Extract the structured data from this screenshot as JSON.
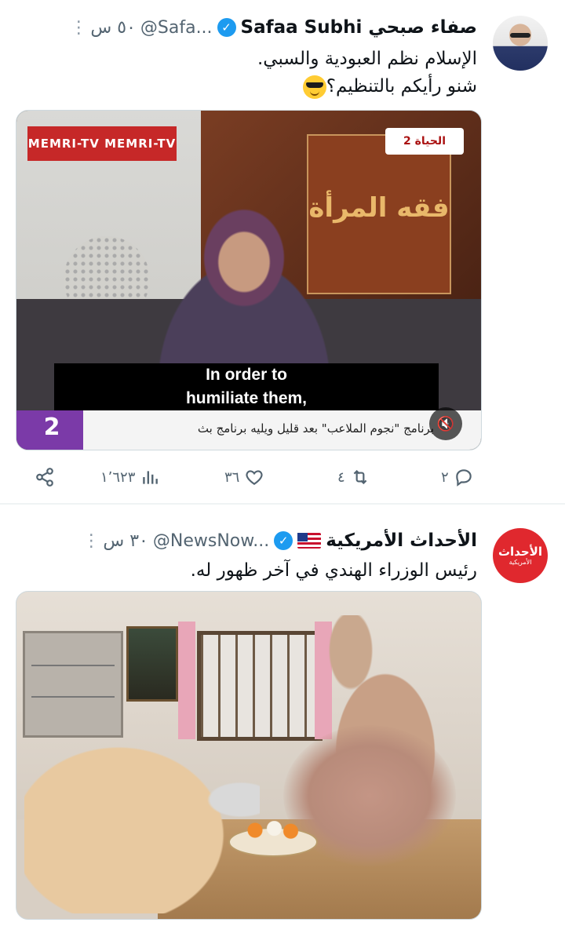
{
  "tweets": [
    {
      "name": "Safaa Subhi صفاء صبحي",
      "handle": "@Safa...",
      "time": "٥٠ س",
      "text_line1": "الإسلام نظم العبودية والسبي.",
      "text_line2": "شنو رأيكم بالتنظيم؟",
      "video": {
        "watermark": "MEMRI-TV  MEMRI-TV",
        "channel": "الحياة 2",
        "show_title": "فقه المرأة",
        "subtitle_line1": "In order to",
        "subtitle_line2": "humiliate them,",
        "ticker": "برنامج \"نجوم الملاعب\" بعد قليل ويليه برنامج بث",
        "channel_number": "2"
      },
      "actions": {
        "replies": "٢",
        "retweets": "٤",
        "likes": "٣٦",
        "views": "١٬٦٢٣"
      }
    },
    {
      "name": "الأحداث الأمريكية",
      "handle": "@NewsNow...",
      "time": "٣٠ س",
      "text_line1": "رئيس الوزراء الهندي في آخر ظهور له.",
      "avatar_text": "الأحداث",
      "avatar_subtext": "الأمريكية"
    }
  ],
  "colors": {
    "text": "#0f1419",
    "secondary": "#536471",
    "verified": "#1d9bf0",
    "divider": "#eff3f4"
  },
  "icons": {
    "reply": "reply-icon",
    "retweet": "retweet-icon",
    "like": "heart-icon",
    "views": "views-chart-icon",
    "share": "share-icon",
    "more": "more-icon",
    "verified": "verified-badge-icon",
    "mute": "mute-icon"
  }
}
